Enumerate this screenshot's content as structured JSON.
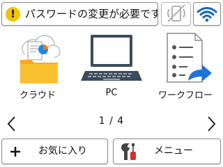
{
  "status": {
    "icon": "warning-icon",
    "message": "パスワードの変更が必要です",
    "accent": "#f5c400"
  },
  "toolbar": {
    "mobile_icon": "mobile-disabled-icon",
    "wifi_icon": "wifi-icon",
    "wifi_color": "#1565c0"
  },
  "apps": [
    {
      "label": "クラウド",
      "icon": "cloud-folder-icon"
    },
    {
      "label": "PC",
      "icon": "laptop-icon"
    },
    {
      "label": "ワークフロー",
      "icon": "workflow-icon"
    }
  ],
  "pager": {
    "text": "1 / 4",
    "current": 1,
    "total": 4
  },
  "bottom": {
    "favorites_label": "お気に入り",
    "menu_label": "メニュー",
    "menu_icon_color": "#d32f2f"
  }
}
